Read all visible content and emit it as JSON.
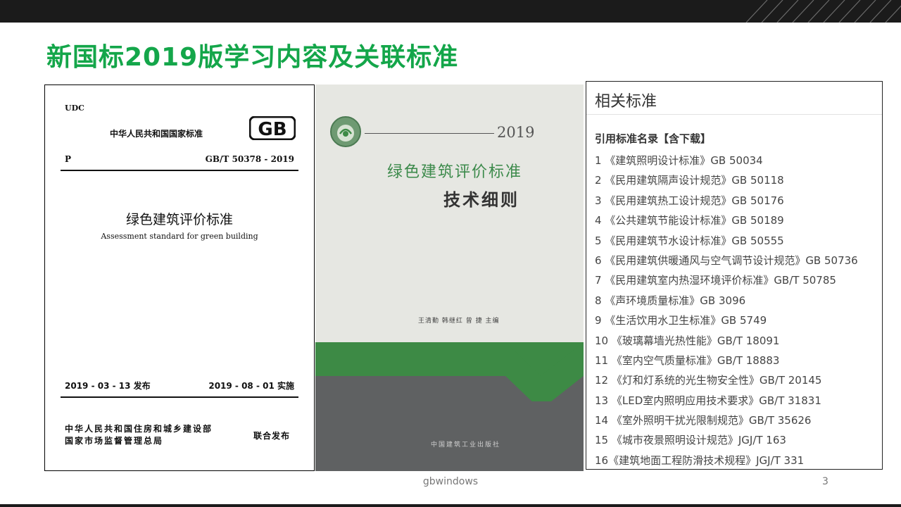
{
  "slide": {
    "title": "新国标2019版学习内容及关联标准",
    "footer_text": "gbwindows",
    "page_number": "3"
  },
  "standard_doc": {
    "udc": "UDC",
    "issuer": "中华人民共和国国家标准",
    "logo_text": "GB",
    "category_letter": "P",
    "code": "GB/T 50378 - 2019",
    "title_cn": "绿色建筑评价标准",
    "title_en": "Assessment standard for green building",
    "publish_date": "2019 - 03 - 13  发布",
    "effective_date": "2019 - 08 - 01  实施",
    "issuer_line1": "中华人民共和国住房和城乡建设部",
    "issuer_line2": "国家市场监督管理总局",
    "joint_release": "联合发布"
  },
  "book_cover": {
    "year": "2019",
    "title_line1": "绿色建筑评价标准",
    "title_line2": "技术细则",
    "editors": "王清勤    韩继红    曾  捷    主编",
    "publisher": "中国建筑工业出版社",
    "colors": {
      "green": "#3d8a45",
      "dark": "#5f6162",
      "paper": "#e6e7e2"
    }
  },
  "related": {
    "heading": "相关标准",
    "subheading": "引用标准名录【含下载】",
    "items": [
      "1 《建筑照明设计标准》GB 50034",
      "2 《民用建筑隔声设计规范》GB 50118",
      "3 《民用建筑热工设计规范》GB 50176",
      "4 《公共建筑节能设计标准》GB 50189",
      "5 《民用建筑节水设计标准》GB 50555",
      "6 《民用建筑供暖通风与空气调节设计规范》GB 50736",
      "7 《民用建筑室内热湿环境评价标准》GB/T 50785",
      "8 《声环境质量标准》GB 3096",
      "9 《生活饮用水卫生标准》GB 5749",
      "10 《玻璃幕墙光热性能》GB/T 18091",
      "11 《室内空气质量标准》GB/T 18883",
      "12 《灯和灯系统的光生物安全性》GB/T 20145",
      "13 《LED室内照明应用技术要求》GB/T 31831",
      "14 《室外照明干扰光限制规范》GB/T 35626",
      "15 《城市夜景照明设计规范》JGJ/T 163",
      "16《建筑地面工程防滑技术规程》JGJ/T 331"
    ]
  },
  "colors": {
    "title_green": "#14a64a",
    "banner": "#1b1b1b"
  }
}
